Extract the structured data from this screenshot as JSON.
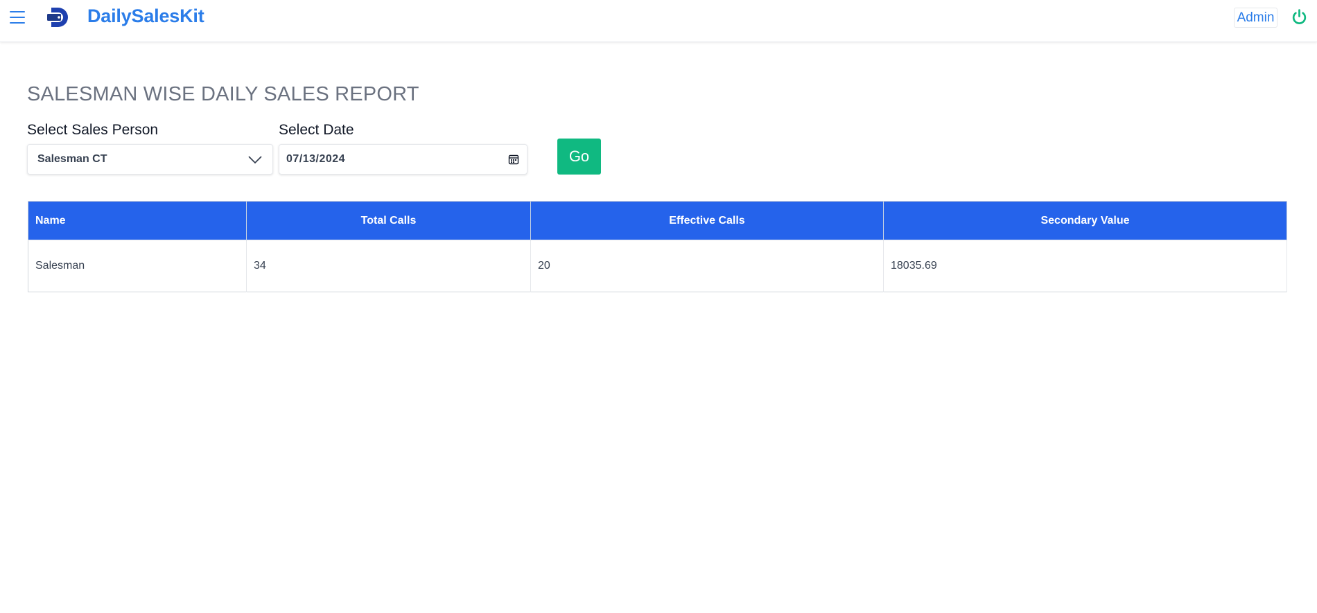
{
  "header": {
    "brand": "DailySalesKit",
    "admin_label": "Admin",
    "accent_color": "#2b7de9",
    "power_color": "#10b981",
    "icons": [
      "menu-icon",
      "logo-icon",
      "power-icon"
    ]
  },
  "page": {
    "title": "SALESMAN WISE DAILY SALES REPORT"
  },
  "filters": {
    "sales_person_label": "Select Sales Person",
    "sales_person_value": "Salesman CT",
    "date_label": "Select Date",
    "date_value": "07/13/2024",
    "go_label": "Go"
  },
  "table": {
    "header_color": "#2563eb",
    "columns": [
      "Name",
      "Total Calls",
      "Effective Calls",
      "Secondary Value"
    ],
    "rows": [
      [
        "Salesman",
        "34",
        "20",
        "18035.69"
      ]
    ]
  }
}
